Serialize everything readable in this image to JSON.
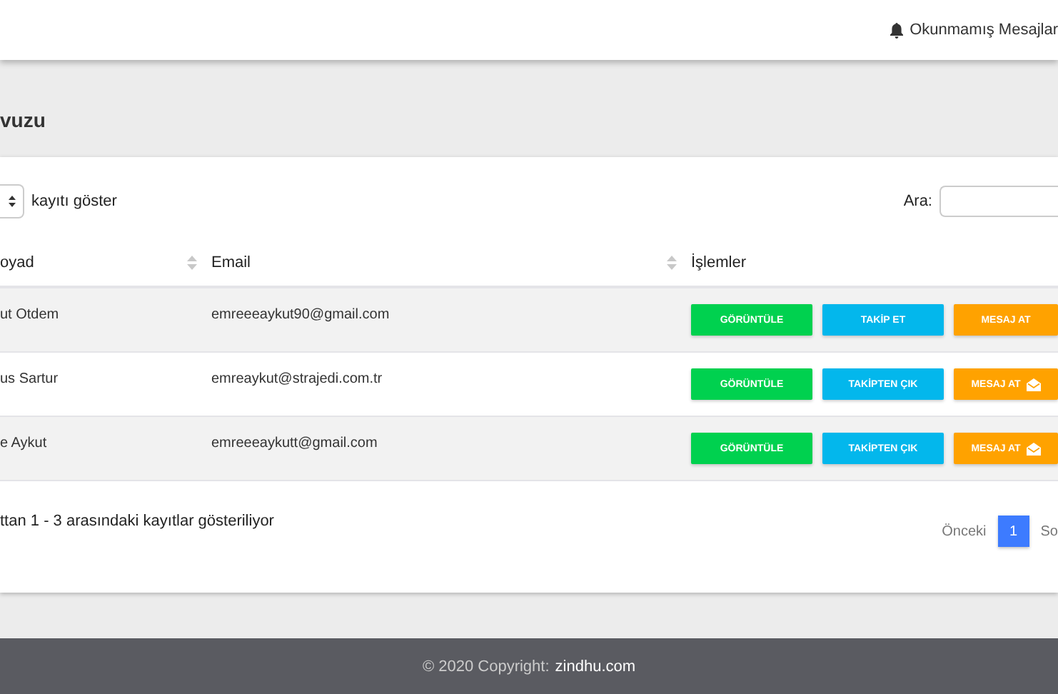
{
  "navbar": {
    "notifications": "Okunmamış Mesajlar"
  },
  "page_title": "vuzu",
  "table_controls": {
    "length_suffix": "kayıtı göster",
    "search_label": "Ara:"
  },
  "table": {
    "columns": [
      {
        "label": "oyad",
        "sortable": true
      },
      {
        "label": "Email",
        "sortable": true
      },
      {
        "label": "İşlemler",
        "sortable": false
      }
    ],
    "rows": [
      {
        "name": "ut Otdem",
        "email": "emreeeaykut90@gmail.com",
        "actions": [
          {
            "kind": "view",
            "label": "GÖRÜNTÜLE",
            "icon": false
          },
          {
            "kind": "follow",
            "label": "TAKİP ET",
            "icon": false
          },
          {
            "kind": "message",
            "label": "MESAJ AT",
            "icon": false
          }
        ]
      },
      {
        "name": "us Sartur",
        "email": "emreaykut@strajedi.com.tr",
        "actions": [
          {
            "kind": "view",
            "label": "GÖRÜNTÜLE",
            "icon": false
          },
          {
            "kind": "follow",
            "label": "TAKİPTEN ÇIK",
            "icon": false
          },
          {
            "kind": "message",
            "label": "MESAJ AT",
            "icon": true
          }
        ]
      },
      {
        "name": "e Aykut",
        "email": "emreeeaykutt@gmail.com",
        "actions": [
          {
            "kind": "view",
            "label": "GÖRÜNTÜLE",
            "icon": false
          },
          {
            "kind": "follow",
            "label": "TAKİPTEN ÇIK",
            "icon": false
          },
          {
            "kind": "message",
            "label": "MESAJ AT",
            "icon": true
          }
        ]
      }
    ]
  },
  "info": "ttan 1 - 3 arasındaki kayıtlar gösteriliyor",
  "pagination": {
    "previous": "Önceki",
    "pages": [
      {
        "label": "1",
        "selected": true
      }
    ],
    "next": "So"
  },
  "footer": {
    "text": "© 2020 Copyright:",
    "link": "zindhu.com"
  }
}
